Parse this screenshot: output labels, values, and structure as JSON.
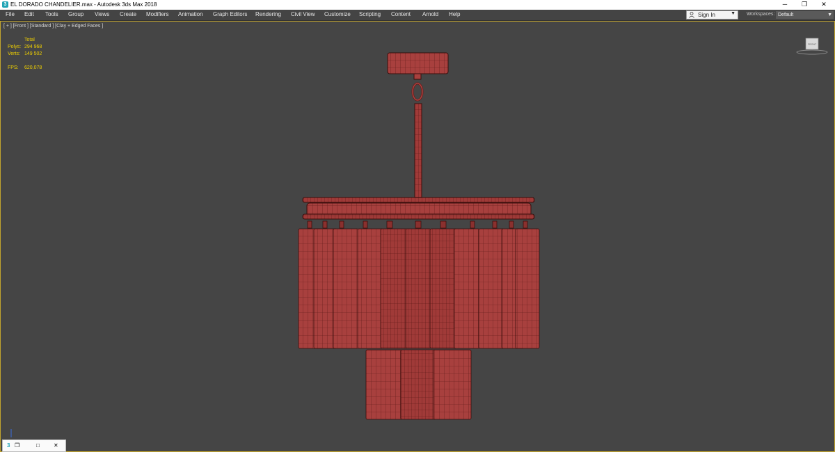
{
  "window": {
    "title": "EL DORADO CHANDELIER.max - Autodesk 3ds Max 2018",
    "app_icon": "3",
    "controls": {
      "minimize": "─",
      "restore": "❐",
      "close": "✕"
    }
  },
  "menu": {
    "items": [
      "File",
      "Edit",
      "Tools",
      "Group",
      "Views",
      "Create",
      "Modifiers",
      "Animation",
      "Graph Editors",
      "Rendering",
      "Civil View",
      "Customize",
      "Scripting",
      "Content",
      "Arnold",
      "Help"
    ]
  },
  "account": {
    "sign_in_label": "Sign In",
    "dropdown_icon": "▼"
  },
  "workspaces": {
    "label": "Workspaces:",
    "value": "Default",
    "dropdown_icon": "▼"
  },
  "viewport": {
    "label": "[ + ] [Front ] [Standard ] [Clay + Edged Faces ]",
    "stats": {
      "header": "Total",
      "polys_label": "Polys:",
      "polys_value": "294 968",
      "verts_label": "Verts:",
      "verts_value": "149 502",
      "fps_label": "FPS:",
      "fps_value": "620,078"
    },
    "viewcube_face": "FRONT",
    "model_color": "#a8403e",
    "wire_color": "#5a1816"
  },
  "taskbar": {
    "icon_label": "3",
    "restore": "❐",
    "maximize": "□",
    "close": "✕"
  }
}
